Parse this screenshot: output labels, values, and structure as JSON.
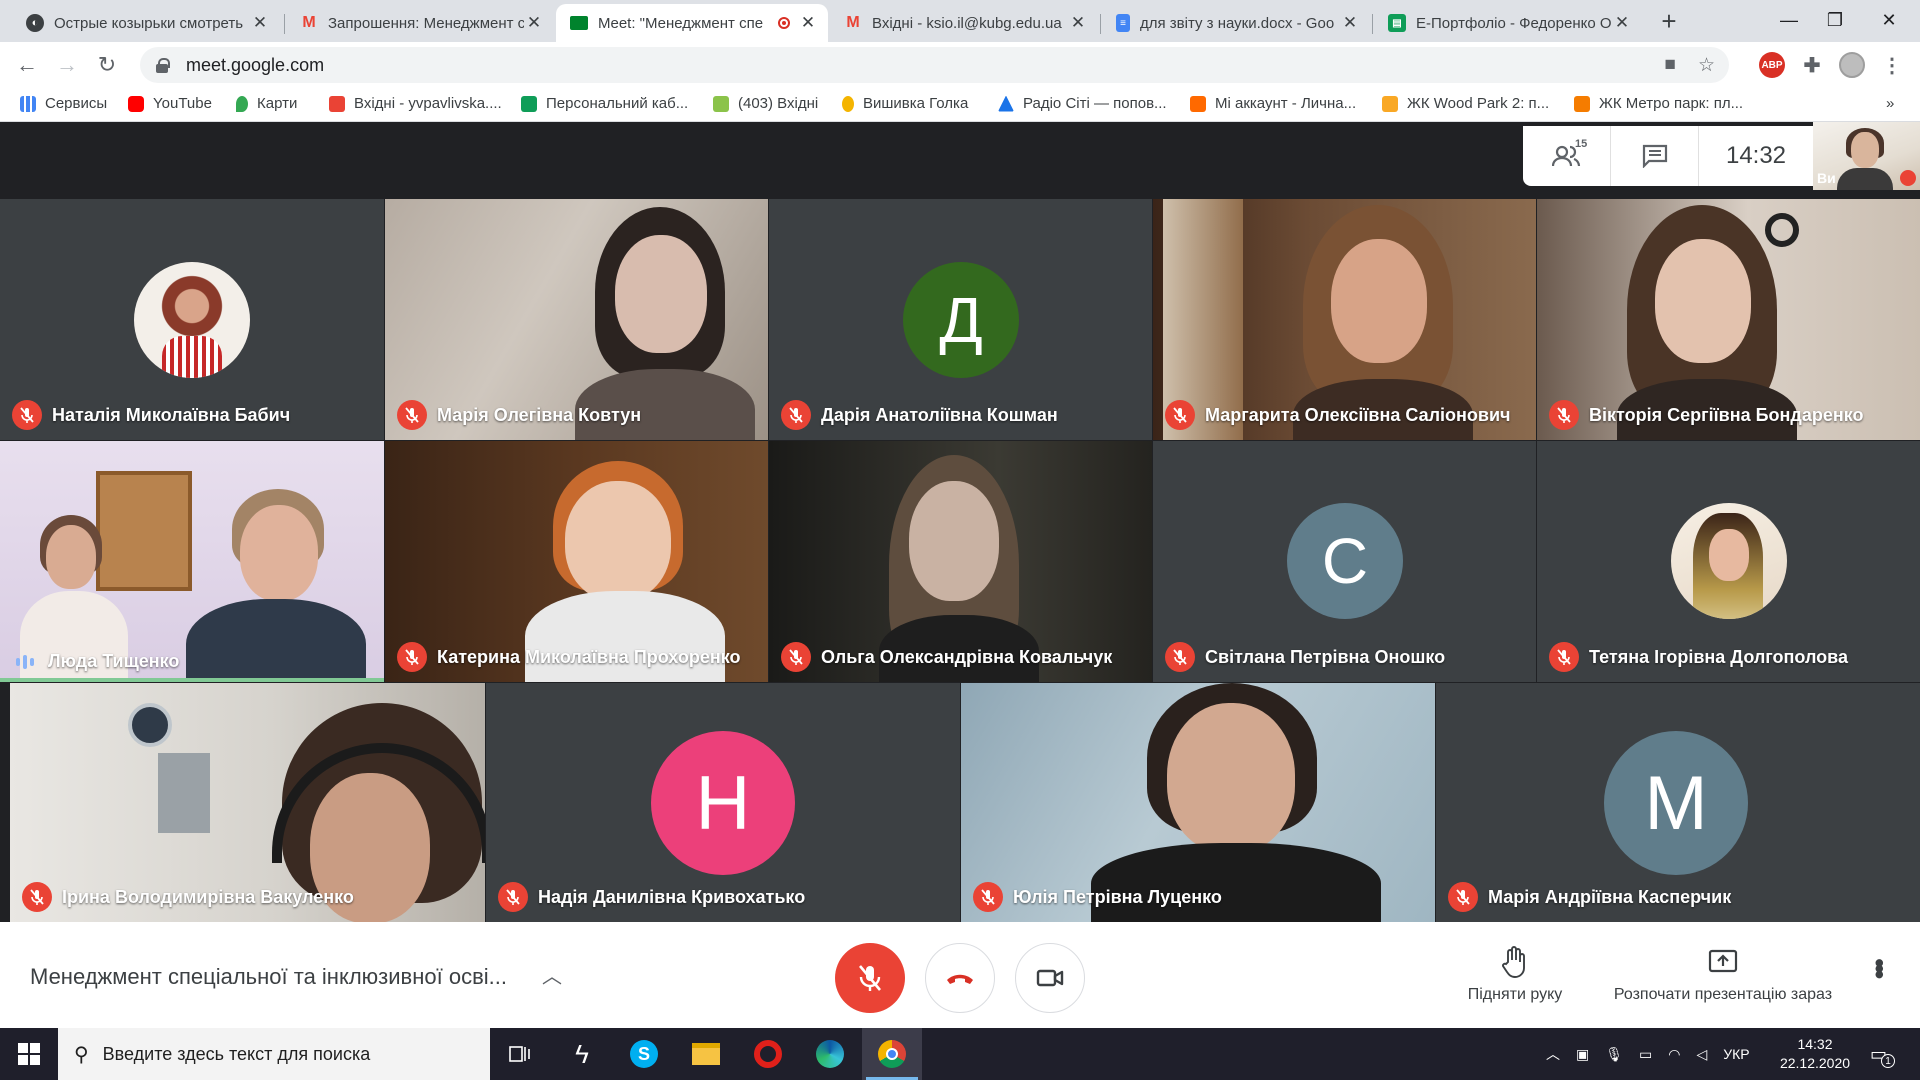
{
  "browser": {
    "tabs": [
      {
        "title": "Острые козырьки смотреть",
        "icon": "globe-icon",
        "active": false
      },
      {
        "title": "Запрошення: Менеджмент с",
        "icon": "gmail-icon",
        "active": false
      },
      {
        "title": "Meet: \"Менеджмент спе",
        "icon": "meet-icon",
        "active": true
      },
      {
        "title": "Вхідні - ksio.il@kubg.edu.ua",
        "icon": "gmail-icon",
        "active": false
      },
      {
        "title": "для звіту з науки.docx - Goo",
        "icon": "docs-icon",
        "active": false
      },
      {
        "title": "E-Портфоліо - Федоренко О",
        "icon": "portfolio-icon",
        "active": false
      }
    ],
    "url": "meet.google.com",
    "bookmarks": [
      {
        "label": "Сервисы",
        "color": "#4285f4"
      },
      {
        "label": "YouTube",
        "color": "#ff0000"
      },
      {
        "label": "Карти",
        "color": "#34a853"
      },
      {
        "label": "Вхідні - yvpavlivska....",
        "color": "#ea4335"
      },
      {
        "label": "Персональний каб...",
        "color": "#0f9d58"
      },
      {
        "label": "(403) Вхідні",
        "color": "#8bc34a"
      },
      {
        "label": "Вишивка Голка",
        "color": "#f4b400"
      },
      {
        "label": "Радіо Сіті — попов...",
        "color": "#1a73e8"
      },
      {
        "label": "Mi аккаунт - Лична...",
        "color": "#ff6900"
      },
      {
        "label": "ЖК Wood Park 2: п...",
        "color": "#f9a825"
      },
      {
        "label": "ЖК Метро парк: пл...",
        "color": "#f57c00"
      }
    ],
    "overflow": "»"
  },
  "meet": {
    "participants_count": "15",
    "time": "14:32",
    "self_label": "Ви",
    "tiles": [
      {
        "name": "Наталія Миколаївна Бабич",
        "kind": "photo",
        "muted": true
      },
      {
        "name": "Марія Олегівна Ковтун",
        "kind": "video",
        "muted": true
      },
      {
        "name": "Дарія Анатоліївна Кошман",
        "kind": "letter",
        "letter": "Д",
        "color": "#33691e",
        "muted": true
      },
      {
        "name": "Маргарита Олексіївна Саліонович",
        "kind": "video",
        "muted": true
      },
      {
        "name": "Вікторія Сергіївна Бондаренко",
        "kind": "video",
        "muted": true
      },
      {
        "name": "Люда Тищенко",
        "kind": "video",
        "muted": false,
        "speaking": true
      },
      {
        "name": "Катерина Миколаївна Прохоренко",
        "kind": "video",
        "muted": true
      },
      {
        "name": "Ольга Олександрівна Ковальчук",
        "kind": "video",
        "muted": true
      },
      {
        "name": "Світлана Петрівна Оношко",
        "kind": "letter",
        "letter": "С",
        "color": "#607d8b",
        "muted": true
      },
      {
        "name": "Тетяна Ігорівна Долгополова",
        "kind": "photo",
        "muted": true
      },
      {
        "name": "Ірина Володимирівна Вакуленко",
        "kind": "video",
        "muted": true
      },
      {
        "name": "Надія Данилівна Кривохатько",
        "kind": "letter",
        "letter": "Н",
        "color": "#ec407a",
        "muted": true
      },
      {
        "name": "Юлія Петрівна Луценко",
        "kind": "video",
        "muted": true
      },
      {
        "name": "Марія Андріївна Касперчик",
        "kind": "letter",
        "letter": "М",
        "color": "#607d8b",
        "muted": true
      }
    ],
    "meeting_title": "Менеджмент спеціальної та інклюзивної осві...",
    "raise_hand_label": "Підняти руку",
    "present_label": "Розпочати презентацію зараз"
  },
  "taskbar": {
    "search_placeholder": "Введите здесь текст для поиска",
    "language": "УКР",
    "time": "14:32",
    "date": "22.12.2020",
    "notifications": "1"
  }
}
